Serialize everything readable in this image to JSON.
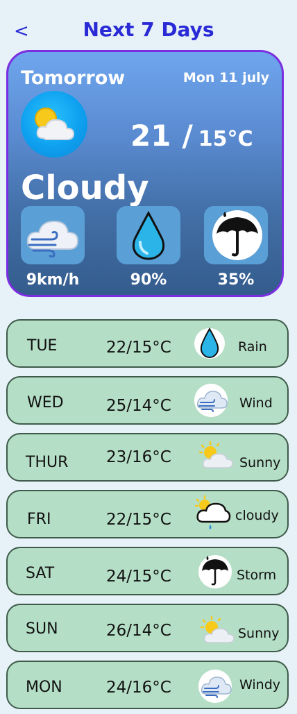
{
  "header": {
    "back_label": "<",
    "title": "Next 7 Days"
  },
  "today_card": {
    "label": "Tomorrow",
    "date": "Mon 11 july",
    "icon": "sun-cloud-icon",
    "temp_high": "21",
    "separator": "/",
    "temp_low": "15°C",
    "condition": "Cloudy",
    "stats": [
      {
        "icon": "wind-icon",
        "value": "9km/h"
      },
      {
        "icon": "droplet-icon",
        "value": "90%"
      },
      {
        "icon": "umbrella-icon",
        "value": "35%"
      }
    ]
  },
  "forecast": [
    {
      "day": "TUE",
      "temp": "22/15°C",
      "icon": "droplet-icon",
      "condition": "Rain"
    },
    {
      "day": "WED",
      "temp": "25/14°C",
      "icon": "wind-icon",
      "condition": "Wind"
    },
    {
      "day": "THUR",
      "temp": "23/16°C",
      "icon": "sun-cloud-icon",
      "condition": "Sunny"
    },
    {
      "day": "FRI",
      "temp": "22/15°C",
      "icon": "sun-rain-cloud-icon",
      "condition": "cloudy"
    },
    {
      "day": "SAT",
      "temp": "24/15°C",
      "icon": "umbrella-icon",
      "condition": "Storm"
    },
    {
      "day": "SUN",
      "temp": "26/14°C",
      "icon": "sun-cloud-icon",
      "condition": "Sunny"
    },
    {
      "day": "MON",
      "temp": "24/16°C",
      "icon": "wind-icon",
      "condition": "Windy"
    }
  ],
  "colors": {
    "accent": "#2a2ad6",
    "card_border": "#7a2ee0",
    "row_bg": "#b5dec6",
    "page_bg": "#e6f2f7"
  }
}
